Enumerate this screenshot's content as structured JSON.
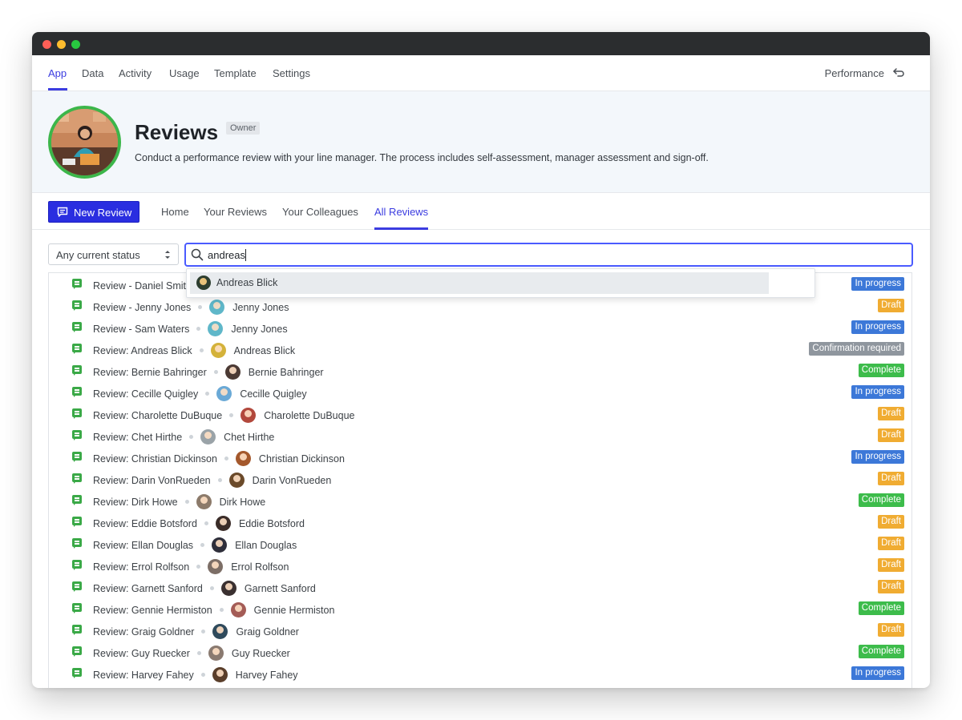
{
  "window": {
    "traffic_lights": [
      "close",
      "minimize",
      "zoom"
    ]
  },
  "topnav": {
    "tabs": [
      {
        "label": "App",
        "active": true
      },
      {
        "label": "Data"
      },
      {
        "label": "Activity"
      },
      {
        "label": "Usage"
      },
      {
        "label": "Template"
      },
      {
        "label": "Settings"
      }
    ],
    "right_label": "Performance",
    "right_icon": "return-arrow-icon"
  },
  "hero": {
    "title": "Reviews",
    "role_badge": "Owner",
    "description": "Conduct a performance review with your line manager. The process includes self-assessment, manager assessment and sign-off."
  },
  "subnav": {
    "new_button": "New Review",
    "tabs": [
      {
        "label": "Home"
      },
      {
        "label": "Your Reviews"
      },
      {
        "label": "Your Colleagues"
      },
      {
        "label": "All Reviews",
        "active": true
      }
    ]
  },
  "filters": {
    "status_select": "Any current status",
    "search_value": "andreas"
  },
  "suggestions": [
    {
      "name": "Andreas Blick"
    }
  ],
  "status_colors": {
    "In progress": "#3c78d8",
    "Draft": "#f0ac32",
    "Complete": "#3dbc4b",
    "Confirmation required": "#8f969e"
  },
  "reviews": [
    {
      "title": "Review - Daniel Smith",
      "person": "Daniel Smith",
      "status": "In progress",
      "avatar_color": "#7a5a44"
    },
    {
      "title": "Review - Jenny Jones",
      "person": "Jenny Jones",
      "status": "Draft",
      "avatar_color": "#5fb7c9"
    },
    {
      "title": "Review - Sam Waters",
      "person": "Jenny Jones",
      "status": "In progress",
      "avatar_color": "#5fb7c9"
    },
    {
      "title": "Review: Andreas Blick",
      "person": "Andreas Blick",
      "status": "Confirmation required",
      "avatar_color": "#d4b23a"
    },
    {
      "title": "Review: Bernie Bahringer",
      "person": "Bernie Bahringer",
      "status": "Complete",
      "avatar_color": "#4b3a34"
    },
    {
      "title": "Review: Cecille Quigley",
      "person": "Cecille Quigley",
      "status": "In progress",
      "avatar_color": "#6aa9d6"
    },
    {
      "title": "Review: Charolette DuBuque",
      "person": "Charolette DuBuque",
      "status": "Draft",
      "avatar_color": "#b2483c"
    },
    {
      "title": "Review: Chet Hirthe",
      "person": "Chet Hirthe",
      "status": "Draft",
      "avatar_color": "#9aa3a8"
    },
    {
      "title": "Review: Christian Dickinson",
      "person": "Christian Dickinson",
      "status": "In progress",
      "avatar_color": "#a4582c"
    },
    {
      "title": "Review: Darin VonRueden",
      "person": "Darin VonRueden",
      "status": "Draft",
      "avatar_color": "#6b4a2a"
    },
    {
      "title": "Review: Dirk Howe",
      "person": "Dirk Howe",
      "status": "Complete",
      "avatar_color": "#8c7a6a"
    },
    {
      "title": "Review: Eddie Botsford",
      "person": "Eddie Botsford",
      "status": "Draft",
      "avatar_color": "#3a2c28"
    },
    {
      "title": "Review: Ellan Douglas",
      "person": "Ellan Douglas",
      "status": "Draft",
      "avatar_color": "#2e2e3a"
    },
    {
      "title": "Review: Errol Rolfson",
      "person": "Errol Rolfson",
      "status": "Draft",
      "avatar_color": "#7c6e66"
    },
    {
      "title": "Review: Garnett Sanford",
      "person": "Garnett Sanford",
      "status": "Draft",
      "avatar_color": "#3a3030"
    },
    {
      "title": "Review: Gennie Hermiston",
      "person": "Gennie Hermiston",
      "status": "Complete",
      "avatar_color": "#a45c56"
    },
    {
      "title": "Review: Graig Goldner",
      "person": "Graig Goldner",
      "status": "Draft",
      "avatar_color": "#2f4a5c"
    },
    {
      "title": "Review: Guy Ruecker",
      "person": "Guy Ruecker",
      "status": "Complete",
      "avatar_color": "#8a7a70"
    },
    {
      "title": "Review: Harvey Fahey",
      "person": "Harvey Fahey",
      "status": "In progress",
      "avatar_color": "#5a3e2a"
    }
  ]
}
